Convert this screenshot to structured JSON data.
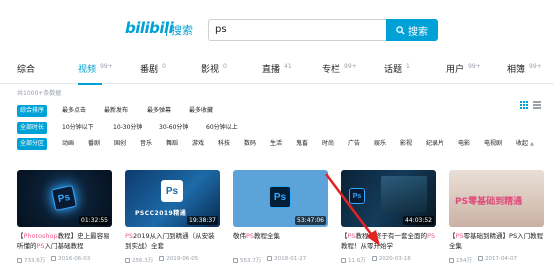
{
  "header": {
    "logo_text": "bilibili",
    "logo_sub": "搜索",
    "search_value": "ps",
    "search_button": "搜索"
  },
  "tabs": [
    {
      "label": "综合",
      "count": ""
    },
    {
      "label": "视频",
      "count": "99+"
    },
    {
      "label": "番剧",
      "count": "0"
    },
    {
      "label": "影视",
      "count": "0"
    },
    {
      "label": "直播",
      "count": "41"
    },
    {
      "label": "专栏",
      "count": "99+"
    },
    {
      "label": "话题",
      "count": "1"
    },
    {
      "label": "用户",
      "count": "99+"
    },
    {
      "label": "相簿",
      "count": "99+"
    }
  ],
  "result_count": "共1000+条数据",
  "filters": {
    "sort": {
      "label": "综合排序",
      "options": [
        "最多点击",
        "最新发布",
        "最多弹幕",
        "最多收藏"
      ]
    },
    "duration": {
      "label": "全部时长",
      "options": [
        "10分钟以下",
        "10-30分钟",
        "30-60分钟",
        "60分钟以上"
      ]
    },
    "zone": {
      "label": "全部分区",
      "options": [
        "动画",
        "番剧",
        "国创",
        "音乐",
        "舞蹈",
        "游戏",
        "科技",
        "数码",
        "生活",
        "鬼畜",
        "时尚",
        "广告",
        "娱乐",
        "影视",
        "纪录片",
        "电影",
        "电视剧"
      ],
      "more": "收起"
    }
  },
  "videos": [
    {
      "duration": "01:32:55",
      "title_pre": "【",
      "title_hl": "Photoshop",
      "title_mid": "教程】史上最容易听懂的",
      "title_hl2": "PS",
      "title_post": "入门基础教程",
      "views": "733.6万",
      "date": "2016-06-03"
    },
    {
      "duration": "19:38:37",
      "title_pre": "",
      "title_hl": "PS",
      "title_mid": "2019从入门到精通（从安装到实战）全套",
      "title_hl2": "",
      "title_post": "",
      "views": "256.3万",
      "date": "2019-06-05",
      "thumb_text": "PSCC2019精通"
    },
    {
      "duration": "53:47:06",
      "title_pre": "敬伟",
      "title_hl": "PS",
      "title_mid": "教程全集",
      "title_hl2": "",
      "title_post": "",
      "views": "553.7万",
      "date": "2018-01-27"
    },
    {
      "duration": "44:03:52",
      "title_pre": "【",
      "title_hl": "PS",
      "title_mid": "教程】终于有一套全面的",
      "title_hl2": "PS",
      "title_post": "教程！从零开始学",
      "views": "11.6万",
      "date": "2020-03-18"
    },
    {
      "duration": "",
      "title_pre": "【",
      "title_hl": "PS",
      "title_mid": "零基础到精通】PS入门教程全集",
      "title_hl2": "",
      "title_post": "",
      "views": "154万",
      "date": "2017-04-07",
      "thumb_text": "PS零基础到精通"
    }
  ]
}
